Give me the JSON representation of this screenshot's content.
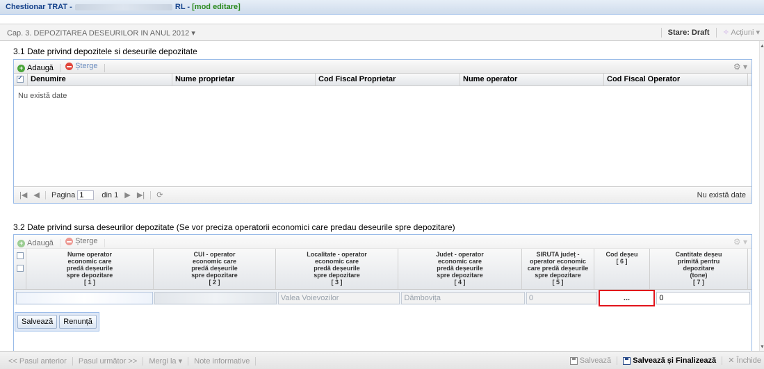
{
  "title": {
    "prefix": "Chestionar TRAT -",
    "suffix": "RL -",
    "mode": "[mod editare]"
  },
  "chapter": {
    "label": "Cap. 3. DEPOZITAREA DESEURILOR IN ANUL 2012",
    "status": "Stare: Draft",
    "actions": "Acțiuni"
  },
  "section1": {
    "title": "3.1 Date privind depozitele si deseurile depozitate",
    "toolbar": {
      "add": "Adaugă",
      "delete": "Șterge"
    },
    "columns": [
      "Denumire",
      "Nume proprietar",
      "Cod Fiscal Proprietar",
      "Nume operator",
      "Cod Fiscal Operator"
    ],
    "empty": "Nu există date",
    "pager": {
      "page_label": "Pagina",
      "page_value": "1",
      "of_label": "din 1",
      "right": "Nu există date"
    }
  },
  "section2": {
    "title": "3.2 Date privind sursa deseurilor depozitate (Se vor preciza operatorii economici care predau deseurile spre depozitare)",
    "toolbar": {
      "add": "Adaugă",
      "delete": "Șterge"
    },
    "columns": [
      {
        "l1": "Nume operator",
        "l2": "economic care",
        "l3": "predă deșeurile",
        "l4": "spre depozitare",
        "l5": "[ 1 ]"
      },
      {
        "l1": "CUI - operator",
        "l2": "economic care",
        "l3": "predă deșeurile",
        "l4": "spre depozitare",
        "l5": "[ 2 ]"
      },
      {
        "l1": "Localitate - operator",
        "l2": "economic care",
        "l3": "predă deșeurile",
        "l4": "spre depozitare",
        "l5": "[ 3 ]"
      },
      {
        "l1": "Judet - operator",
        "l2": "economic care",
        "l3": "predă deșeurile",
        "l4": "spre depozitare",
        "l5": "[ 4 ]"
      },
      {
        "l1": "SIRUTA județ -",
        "l2": "operator economic",
        "l3": "care predă deșeurile",
        "l4": "spre depozitare",
        "l5": "[ 5 ]"
      },
      {
        "l1": "Cod deșeu",
        "l2": "[ 6 ]",
        "l3": "",
        "l4": "",
        "l5": ""
      },
      {
        "l1": "Cantitate deșeu",
        "l2": "primită pentru",
        "l3": "depozitare",
        "l4": "(tone)",
        "l5": "[ 7 ]"
      }
    ],
    "edit_row": {
      "locality": "Valea Voievozilor",
      "county": "Dâmbovița",
      "siruta": "0",
      "code_button": "...",
      "quantity": "0"
    },
    "save": "Salvează",
    "cancel": "Renunță"
  },
  "footer": {
    "prev": "<< Pasul anterior",
    "next": "Pasul următor >>",
    "goto": "Mergi la",
    "notes": "Note informative",
    "save": "Salvează",
    "save_finalize": "Salvează și Finalizează",
    "close": "Închide"
  }
}
